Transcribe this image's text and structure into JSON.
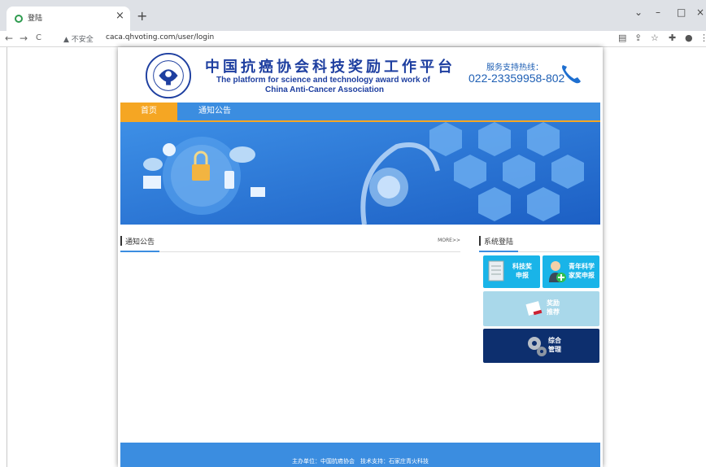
{
  "browser": {
    "tab_title": "登陆",
    "tab_close": "×",
    "new_tab": "+",
    "win_min": "–",
    "win_max": "□",
    "win_close": "×",
    "win_menu": "⌄",
    "back": "←",
    "forward": "→",
    "reload": "C",
    "security_warning": "▲ 不安全",
    "url": "caca.qhvoting.com/user/login"
  },
  "site": {
    "title_cn": "中国抗癌协会科技奖励工作平台",
    "title_en_line1": "The platform for science and technology award work of",
    "title_en_line2": "China Anti-Cancer Association",
    "hotline_label": "服务支持热线：",
    "hotline_number": "022-23359958-802",
    "logo_ring_top": "中國抗癌協會",
    "logo_ring_bottom": "CHINA ANTI-CANCER ASSOCIATION"
  },
  "nav": {
    "items": [
      {
        "label": "首页",
        "active": true
      },
      {
        "label": "通知公告",
        "active": false
      }
    ]
  },
  "notices": {
    "title": "通知公告",
    "more": "MORE>>",
    "items": []
  },
  "login": {
    "title": "系统登陆",
    "tiles": [
      {
        "label_line1": "科技奖",
        "label_line2": "申报",
        "color": "#19b4e8",
        "icon": "document-icon"
      },
      {
        "label_line1": "青年科学",
        "label_line2": "家奖申报",
        "color": "#19b4e8",
        "icon": "person-add-icon"
      },
      {
        "label_line1": "奖励",
        "label_line2": "推荐",
        "color": "#a9d8ea",
        "icon": "pen-paper-icon"
      },
      {
        "label_line1": "综合",
        "label_line2": "管理",
        "color": "#0d2f6e",
        "icon": "gears-icon"
      }
    ]
  },
  "footer": {
    "text": "主办单位：中国抗癌协会　技术支持：石家庄青火科技"
  },
  "colors": {
    "nav_blue": "#3b8de0",
    "accent_orange": "#f5a623",
    "title_blue": "#1e3fa0"
  }
}
